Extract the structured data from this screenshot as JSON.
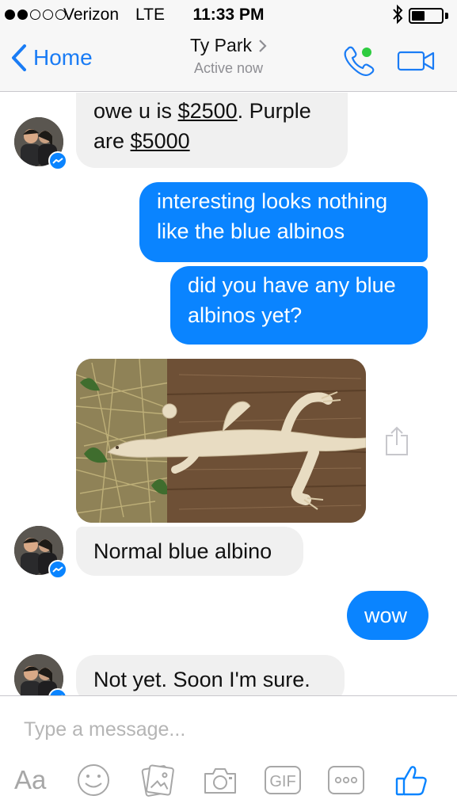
{
  "status_bar": {
    "carrier": "Verizon",
    "network": "LTE",
    "time": "11:33 PM",
    "signal_bars_filled": 2,
    "signal_bars_total": 5,
    "battery_level": 0.45
  },
  "header": {
    "back_label": "Home",
    "contact_name": "Ty Park",
    "contact_status": "Active now",
    "call_icon": "phone-icon",
    "video_icon": "video-camera-icon",
    "online_color": "#2ecc40"
  },
  "messages": [
    {
      "direction": "incoming",
      "parts": [
        "owe u is ",
        "$2500",
        ". Purple"
      ],
      "line2": [
        "are ",
        "$5000"
      ]
    },
    {
      "direction": "outgoing",
      "text": "interesting looks nothing like the blue albinos"
    },
    {
      "direction": "outgoing",
      "text": "did you have any blue albinos yet?"
    },
    {
      "direction": "incoming",
      "type": "photo",
      "alt": "albino monitor lizard on wooden board"
    },
    {
      "direction": "incoming",
      "text": "Normal blue albino"
    },
    {
      "direction": "outgoing",
      "text": "wow"
    },
    {
      "direction": "incoming",
      "text": "Not yet. Soon I'm sure."
    }
  ],
  "composer": {
    "placeholder": "Type a message...",
    "text_format_label": "Aa",
    "gif_label": "GIF",
    "icons": [
      "text-format-icon",
      "emoji-icon",
      "photo-gallery-icon",
      "camera-icon",
      "gif-icon",
      "more-icon",
      "like-icon"
    ]
  },
  "colors": {
    "accent": "#0a84ff",
    "incoming_bubble": "#f0f0f0",
    "nav_blue": "#1a7cf5",
    "icon_gray": "#a7a7a7"
  }
}
